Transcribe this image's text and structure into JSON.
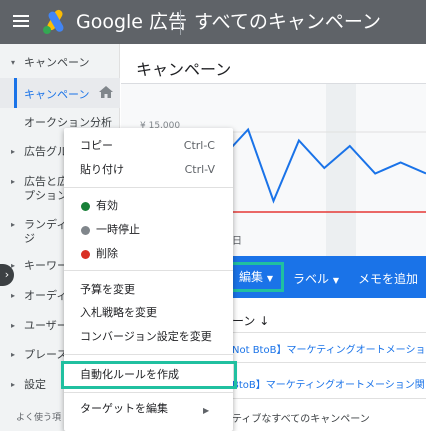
{
  "header": {
    "brand": "Google 広告",
    "page_name": "すべてのキャンペーン"
  },
  "sidenav": {
    "section": "キャンペーン",
    "selected": "キャンペーン",
    "items": [
      "オークション分析",
      "広告グル",
      "広告と広",
      "プション",
      "ランディ",
      "ジ",
      "キーワー",
      "オーディ",
      "ユーザー",
      "プレース",
      "設定",
      "よく使う項"
    ]
  },
  "main": {
    "title": "キャンペーン",
    "y_tick": "¥ 15,000",
    "x_tick": "日"
  },
  "chart_data": {
    "type": "line",
    "series": [
      {
        "values": [
          0.55,
          0.5,
          0.62,
          0.35,
          0.7,
          0.95,
          0.3,
          0.85,
          0.6,
          0.8,
          0.55,
          0.65,
          0.55
        ]
      }
    ]
  },
  "toolbar": {
    "edit": "編集",
    "label": "ラベル",
    "memo": "メモを追加"
  },
  "table": {
    "col_header": "ーン ↓",
    "rows": [
      "Not BtoB】マーケティングオートメーション",
      "BtoB】マーケティングオートメーション関",
      "ティブなすべてのキャンペーン"
    ]
  },
  "menu": {
    "copy": "コピー",
    "copy_shortcut": "Ctrl-C",
    "paste": "貼り付け",
    "paste_shortcut": "Ctrl-V",
    "enable": "有効",
    "pause": "一時停止",
    "remove": "削除",
    "change_budget": "予算を変更",
    "bid_strategy": "入札戦略を変更",
    "conversion_settings": "コンバージョン設定を変更",
    "create_rule": "自動化ルールを作成",
    "edit_targeting": "ターゲットを編集"
  },
  "colors": {
    "enabled": "#188038",
    "paused": "#80868b",
    "removed": "#d93025",
    "accent": "#1a73e8",
    "highlight": "#20c0a0"
  }
}
